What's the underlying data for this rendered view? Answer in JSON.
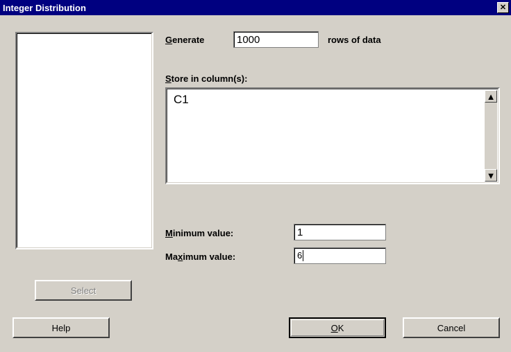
{
  "title": "Integer Distribution",
  "close_glyph": "✕",
  "labels": {
    "generate": "enerate",
    "generate_u": "G",
    "rows": "rows of data",
    "store": "tore in column(s):",
    "store_u": "S",
    "min": "inimum value:",
    "min_u": "M",
    "max": "aximum value:",
    "max_u": "M",
    "max_u2": "x"
  },
  "inputs": {
    "generate": "1000",
    "columns": "C1",
    "min": "1",
    "max": "6"
  },
  "scroll": {
    "up": "▲",
    "down": "▼"
  },
  "buttons": {
    "select": "Select",
    "help": "Help",
    "ok": "K",
    "ok_u": "O",
    "cancel": "Cancel"
  }
}
